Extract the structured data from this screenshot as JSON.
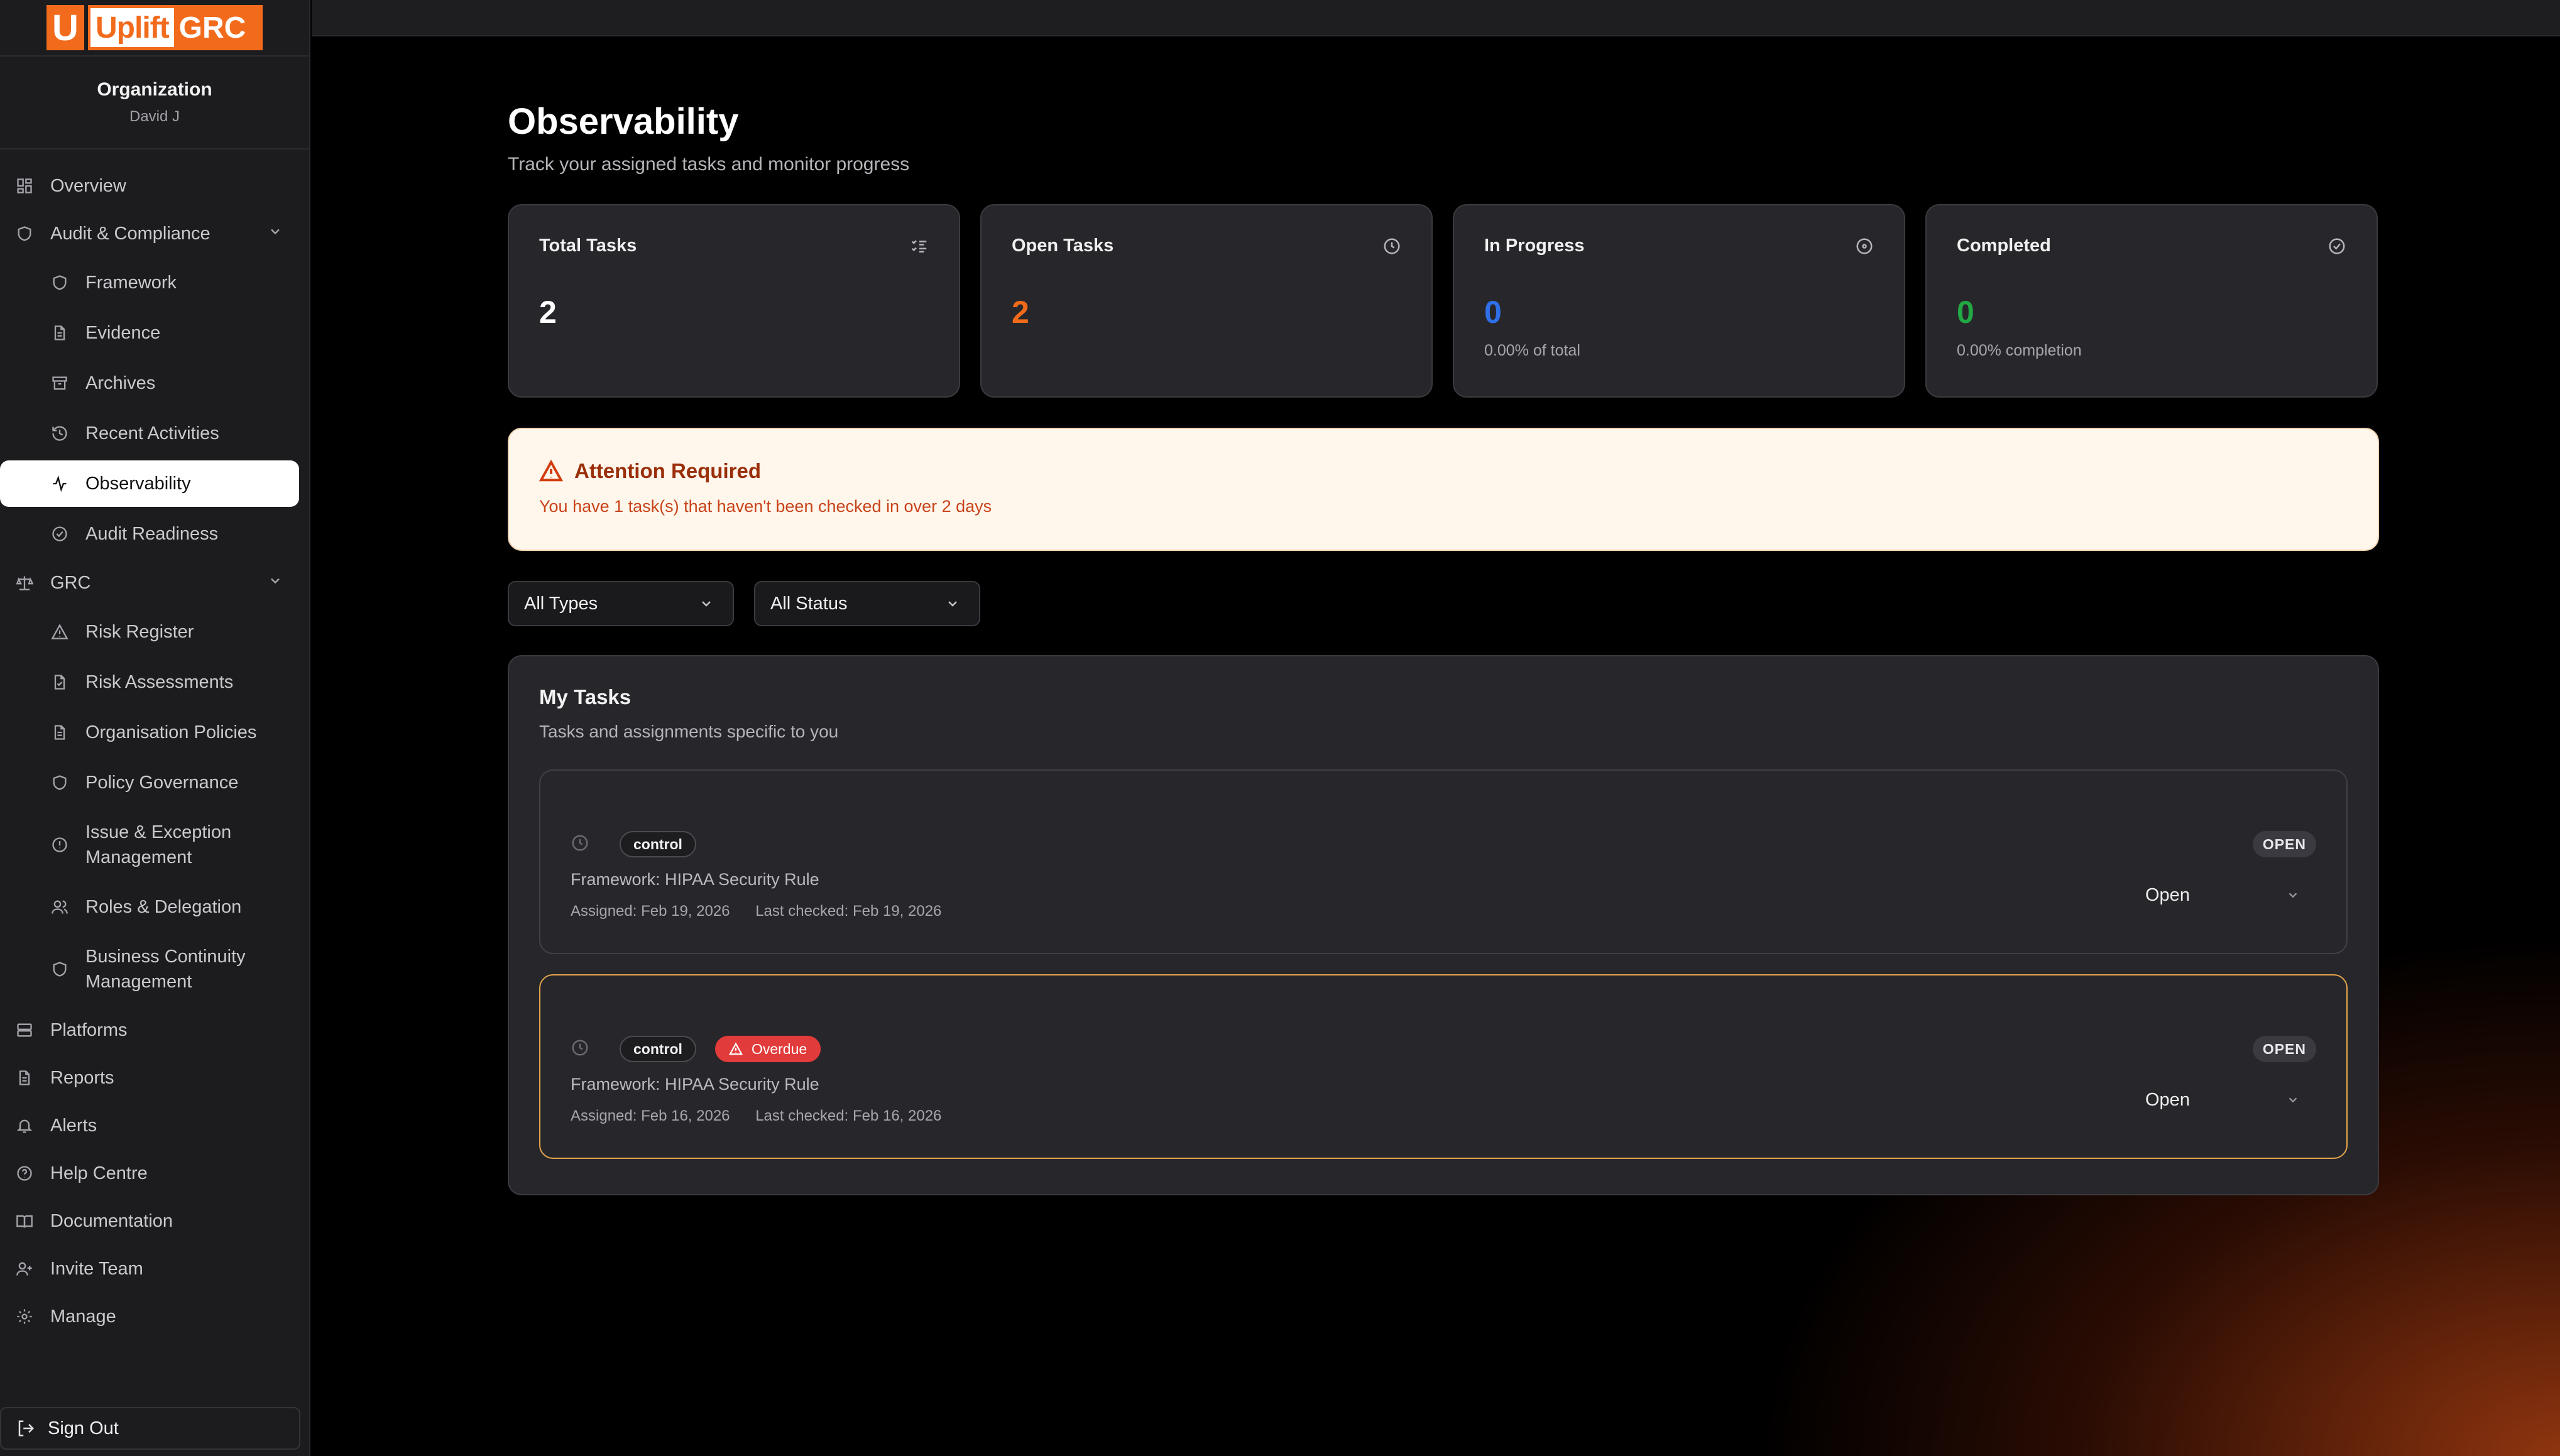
{
  "brand": {
    "u_letter": "U",
    "uplift": "Uplift",
    "grc": "GRC",
    "color": "#f26b1d"
  },
  "org": {
    "title": "Organization",
    "user": "David J"
  },
  "sidebar": {
    "overview": "Overview",
    "audit_group": "Audit & Compliance",
    "audit_items": [
      "Framework",
      "Evidence",
      "Archives",
      "Recent Activities",
      "Observability",
      "Audit Readiness"
    ],
    "grc_group": "GRC",
    "grc_items": [
      "Risk Register",
      "Risk Assessments",
      "Organisation Policies",
      "Policy Governance",
      "Issue & Exception Management",
      "Roles & Delegation",
      "Business Continuity Management"
    ],
    "bottom_items": [
      "Platforms",
      "Reports",
      "Alerts",
      "Help Centre",
      "Documentation",
      "Invite Team",
      "Manage"
    ],
    "sign_out": "Sign Out",
    "active": "Observability"
  },
  "page": {
    "title": "Observability",
    "subtitle": "Track your assigned tasks and monitor progress"
  },
  "stats": [
    {
      "label": "Total Tasks",
      "value": "2",
      "note": "",
      "icon": "list-checks-icon",
      "color": "#ffffff"
    },
    {
      "label": "Open Tasks",
      "value": "2",
      "note": "",
      "icon": "clock-icon",
      "color": "#f06a1a"
    },
    {
      "label": "In Progress",
      "value": "0",
      "note": "0.00% of total",
      "icon": "circle-dot-icon",
      "color": "#2f6fe8"
    },
    {
      "label": "Completed",
      "value": "0",
      "note": "0.00% completion",
      "icon": "circle-check-icon",
      "color": "#22a845"
    }
  ],
  "alert": {
    "title": "Attention Required",
    "text": "You have 1 task(s) that haven't been checked in over 2 days"
  },
  "filters": {
    "types": "All Types",
    "status": "All Status"
  },
  "tasks": {
    "title": "My Tasks",
    "subtitle": "Tasks and assignments specific to you",
    "items": [
      {
        "type": "control",
        "overdue_label": "",
        "framework": "Framework: HIPAA Security Rule",
        "assigned": "Assigned: Feb 19, 2026",
        "last_checked": "Last checked: Feb 19, 2026",
        "status_badge": "OPEN",
        "status_value": "Open"
      },
      {
        "type": "control",
        "overdue_label": "Overdue",
        "framework": "Framework: HIPAA Security Rule",
        "assigned": "Assigned: Feb 16, 2026",
        "last_checked": "Last checked: Feb 16, 2026",
        "status_badge": "OPEN",
        "status_value": "Open"
      }
    ]
  }
}
